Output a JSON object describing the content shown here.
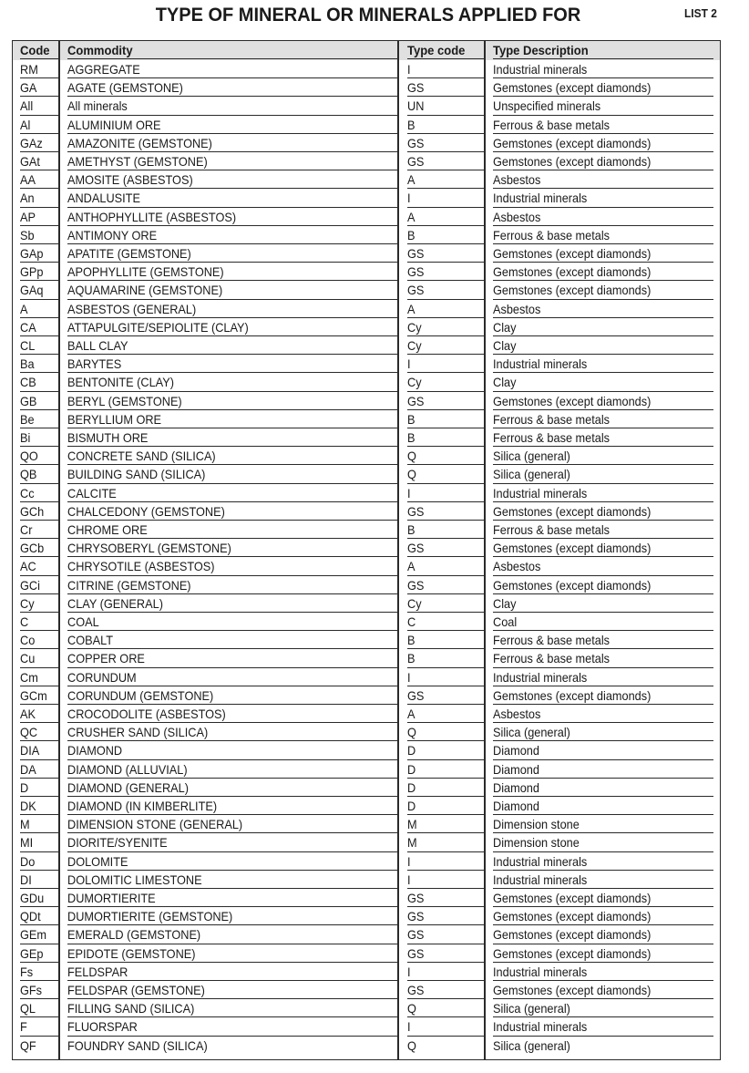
{
  "document": {
    "title": "TYPE OF MINERAL OR MINERALS APPLIED FOR",
    "list_label": "LIST 2"
  },
  "table": {
    "headers": {
      "code": "Code",
      "commodity": "Commodity",
      "type_code": "Type code",
      "type_description": "Type Description"
    },
    "rows": [
      {
        "code": "RM",
        "commodity": " AGGREGATE",
        "type_code": "I",
        "type_description": "Industrial minerals"
      },
      {
        "code": "GA",
        "commodity": "AGATE (GEMSTONE)",
        "type_code": "GS",
        "type_description": "Gemstones (except diamonds)"
      },
      {
        "code": "All",
        "commodity": "All minerals",
        "type_code": "UN",
        "type_description": "Unspecified minerals"
      },
      {
        "code": "Al",
        "commodity": "ALUMINIUM ORE",
        "type_code": "B",
        "type_description": "Ferrous & base metals"
      },
      {
        "code": "GAz",
        "commodity": "AMAZONITE (GEMSTONE)",
        "type_code": "GS",
        "type_description": "Gemstones (except diamonds)"
      },
      {
        "code": "GAt",
        "commodity": "AMETHYST (GEMSTONE)",
        "type_code": "GS",
        "type_description": "Gemstones (except diamonds)"
      },
      {
        "code": "AA",
        "commodity": "AMOSITE (ASBESTOS)",
        "type_code": "A",
        "type_description": "Asbestos"
      },
      {
        "code": "An",
        "commodity": "ANDALUSITE",
        "type_code": "I",
        "type_description": "Industrial minerals"
      },
      {
        "code": "AP",
        "commodity": "ANTHOPHYLLITE (ASBESTOS)",
        "type_code": "A",
        "type_description": "Asbestos"
      },
      {
        "code": "Sb",
        "commodity": "ANTIMONY ORE",
        "type_code": "B",
        "type_description": "Ferrous & base metals"
      },
      {
        "code": "GAp",
        "commodity": "APATITE (GEMSTONE)",
        "type_code": "GS",
        "type_description": "Gemstones (except diamonds)"
      },
      {
        "code": "GPp",
        "commodity": "APOPHYLLITE (GEMSTONE)",
        "type_code": "GS",
        "type_description": "Gemstones (except diamonds)"
      },
      {
        "code": "GAq",
        "commodity": "AQUAMARINE (GEMSTONE)",
        "type_code": "GS",
        "type_description": "Gemstones (except diamonds)"
      },
      {
        "code": "A",
        "commodity": "ASBESTOS (GENERAL)",
        "type_code": "A",
        "type_description": "Asbestos"
      },
      {
        "code": "CA",
        "commodity": "ATTAPULGITE/SEPIOLITE (CLAY)",
        "type_code": "Cy",
        "type_description": "Clay"
      },
      {
        "code": "CL",
        "commodity": "BALL CLAY",
        "type_code": "Cy",
        "type_description": "Clay"
      },
      {
        "code": "Ba",
        "commodity": "BARYTES",
        "type_code": "I",
        "type_description": "Industrial minerals"
      },
      {
        "code": "CB",
        "commodity": "BENTONITE (CLAY)",
        "type_code": "Cy",
        "type_description": "Clay"
      },
      {
        "code": "GB",
        "commodity": "BERYL (GEMSTONE)",
        "type_code": "GS",
        "type_description": "Gemstones (except diamonds)"
      },
      {
        "code": "Be",
        "commodity": "BERYLLIUM ORE",
        "type_code": "B",
        "type_description": "Ferrous & base metals"
      },
      {
        "code": "Bi",
        "commodity": "BISMUTH ORE",
        "type_code": "B",
        "type_description": "Ferrous & base metals"
      },
      {
        "code": "QO",
        "commodity": "CONCRETE SAND (SILICA)",
        "type_code": "Q",
        "type_description": "Silica (general)"
      },
      {
        "code": "QB",
        "commodity": "BUILDING SAND (SILICA)",
        "type_code": "Q",
        "type_description": "Silica (general)"
      },
      {
        "code": "Cc",
        "commodity": "CALCITE",
        "type_code": "I",
        "type_description": "Industrial minerals"
      },
      {
        "code": "GCh",
        "commodity": "CHALCEDONY (GEMSTONE)",
        "type_code": "GS",
        "type_description": "Gemstones (except diamonds)"
      },
      {
        "code": "Cr",
        "commodity": "CHROME ORE",
        "type_code": "B",
        "type_description": "Ferrous & base metals"
      },
      {
        "code": "GCb",
        "commodity": "CHRYSOBERYL (GEMSTONE)",
        "type_code": "GS",
        "type_description": "Gemstones (except diamonds)"
      },
      {
        "code": "AC",
        "commodity": "CHRYSOTILE (ASBESTOS)",
        "type_code": "A",
        "type_description": "Asbestos"
      },
      {
        "code": "GCi",
        "commodity": "CITRINE (GEMSTONE)",
        "type_code": "GS",
        "type_description": "Gemstones (except diamonds)"
      },
      {
        "code": "Cy",
        "commodity": "CLAY (GENERAL)",
        "type_code": "Cy",
        "type_description": "Clay"
      },
      {
        "code": "C",
        "commodity": "COAL",
        "type_code": "C",
        "type_description": "Coal"
      },
      {
        "code": "Co",
        "commodity": "COBALT",
        "type_code": "B",
        "type_description": "Ferrous & base metals"
      },
      {
        "code": "Cu",
        "commodity": "COPPER ORE",
        "type_code": "B",
        "type_description": "Ferrous & base metals"
      },
      {
        "code": "Cm",
        "commodity": "CORUNDUM",
        "type_code": "I",
        "type_description": "Industrial minerals"
      },
      {
        "code": "GCm",
        "commodity": "CORUNDUM (GEMSTONE)",
        "type_code": "GS",
        "type_description": "Gemstones (except diamonds)"
      },
      {
        "code": "AK",
        "commodity": "CROCODOLITE (ASBESTOS)",
        "type_code": "A",
        "type_description": "Asbestos"
      },
      {
        "code": "QC",
        "commodity": "CRUSHER SAND (SILICA)",
        "type_code": "Q",
        "type_description": "Silica (general)"
      },
      {
        "code": "DIA",
        "commodity": "DIAMOND",
        "type_code": "D",
        "type_description": "Diamond"
      },
      {
        "code": "DA",
        "commodity": "DIAMOND (ALLUVIAL)",
        "type_code": "D",
        "type_description": "Diamond"
      },
      {
        "code": "D",
        "commodity": "DIAMOND (GENERAL)",
        "type_code": "D",
        "type_description": "Diamond"
      },
      {
        "code": "DK",
        "commodity": "DIAMOND (IN KIMBERLITE)",
        "type_code": "D",
        "type_description": "Diamond"
      },
      {
        "code": "M",
        "commodity": "DIMENSION STONE (GENERAL)",
        "type_code": "M",
        "type_description": "Dimension stone"
      },
      {
        "code": "MI",
        "commodity": "DIORITE/SYENITE",
        "type_code": "M",
        "type_description": "Dimension stone"
      },
      {
        "code": "Do",
        "commodity": "DOLOMITE",
        "type_code": "I",
        "type_description": "Industrial minerals"
      },
      {
        "code": "DI",
        "commodity": "DOLOMITIC LIMESTONE",
        "type_code": "I",
        "type_description": "Industrial minerals"
      },
      {
        "code": "GDu",
        "commodity": "DUMORTIERITE",
        "type_code": "GS",
        "type_description": "Gemstones (except diamonds)"
      },
      {
        "code": "QDt",
        "commodity": "DUMORTIERITE (GEMSTONE)",
        "type_code": "GS",
        "type_description": "Gemstones (except diamonds)"
      },
      {
        "code": "GEm",
        "commodity": "EMERALD (GEMSTONE)",
        "type_code": "GS",
        "type_description": "Gemstones (except diamonds)"
      },
      {
        "code": "GEp",
        "commodity": "EPIDOTE (GEMSTONE)",
        "type_code": "GS",
        "type_description": "Gemstones (except diamonds)"
      },
      {
        "code": "Fs",
        "commodity": "FELDSPAR",
        "type_code": "I",
        "type_description": "Industrial minerals"
      },
      {
        "code": "GFs",
        "commodity": "FELDSPAR (GEMSTONE)",
        "type_code": "GS",
        "type_description": "Gemstones (except diamonds)"
      },
      {
        "code": "QL",
        "commodity": "FILLING SAND (SILICA)",
        "type_code": "Q",
        "type_description": "Silica (general)"
      },
      {
        "code": "F",
        "commodity": "FLUORSPAR",
        "type_code": "I",
        "type_description": "Industrial minerals"
      },
      {
        "code": "QF",
        "commodity": "FOUNDRY SAND (SILICA)",
        "type_code": "Q",
        "type_description": "Silica (general)"
      }
    ]
  }
}
